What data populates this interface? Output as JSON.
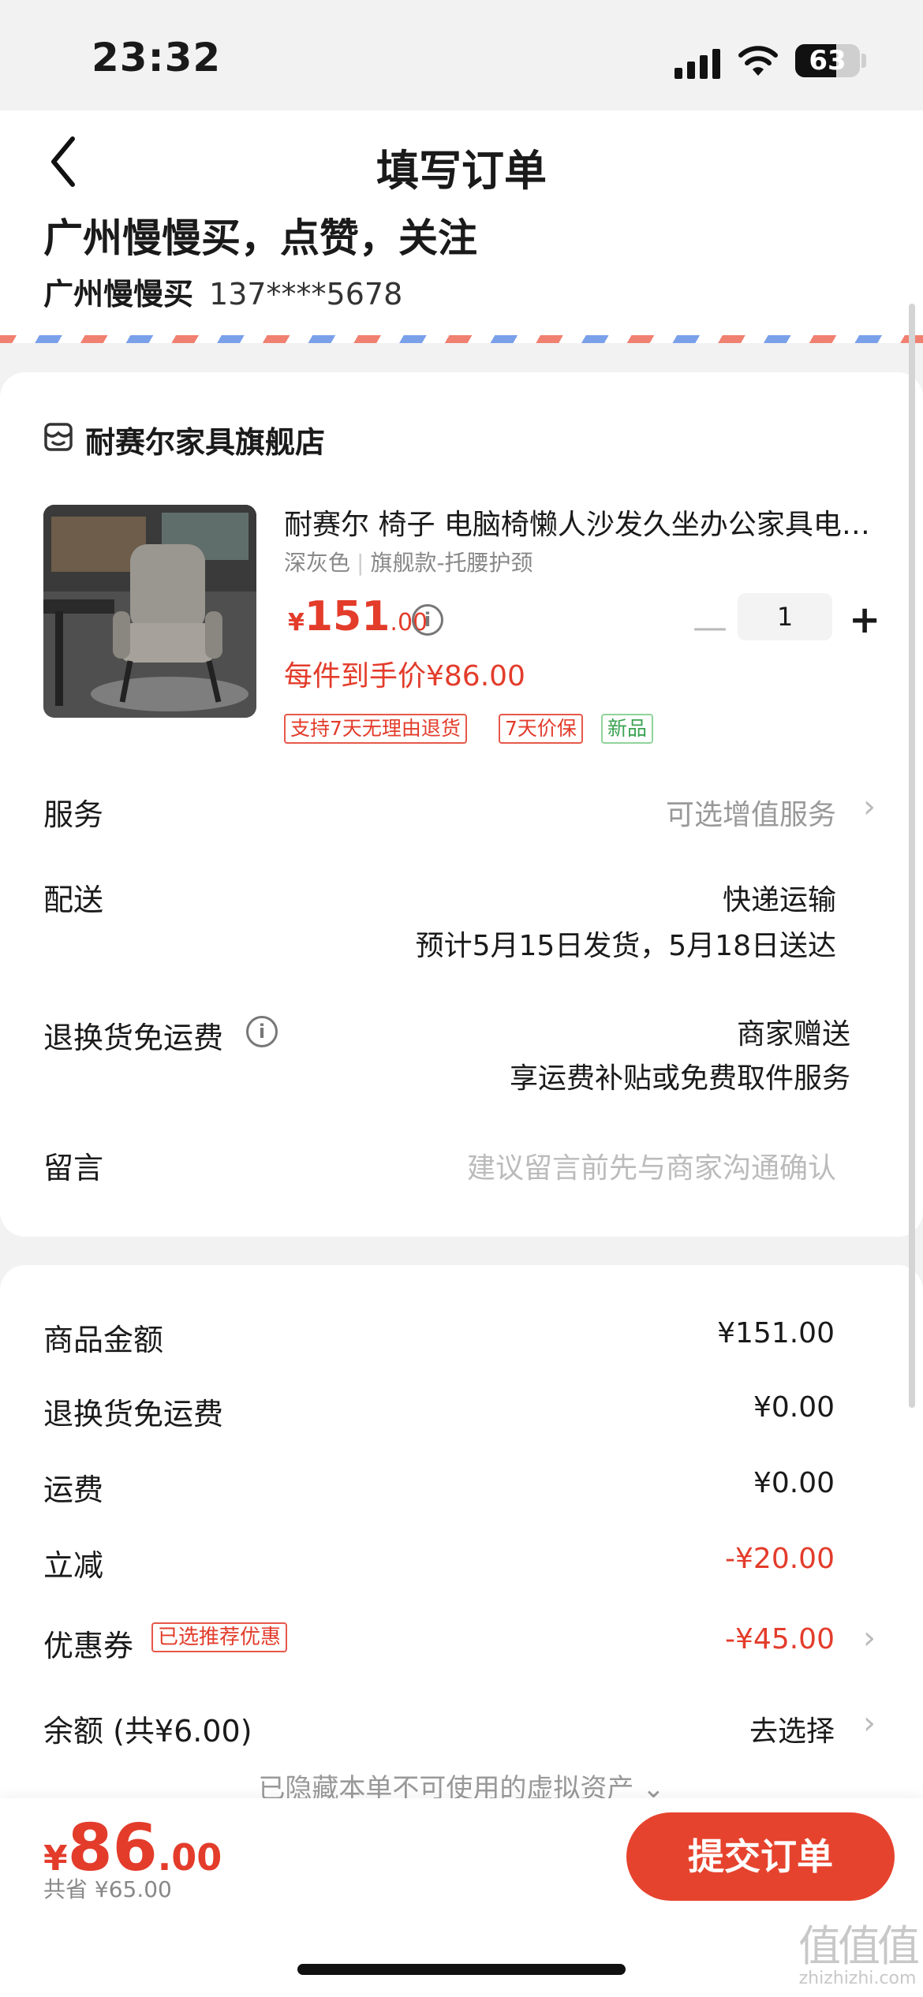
{
  "status_bar": {
    "time": "23:32",
    "battery": "63"
  },
  "header": {
    "title": "填写订单"
  },
  "address": {
    "name_line": "广州慢慢买，点赞，关注",
    "contact_name": "广州慢慢买",
    "phone": "137****5678"
  },
  "store": {
    "name": "耐赛尔家具旗舰店"
  },
  "product": {
    "title": "耐赛尔 椅子 电脑椅懒人沙发久坐办公家具电竞椅",
    "spec_color": "深灰色",
    "spec_model": "旗舰款-托腰护颈",
    "price_currency": "¥",
    "price_int": "151",
    "price_dec": ".00",
    "unit_price": "每件到手价¥86.00",
    "quantity": "1",
    "tags": [
      "支持7天无理由退货",
      "7天价保",
      "新品"
    ]
  },
  "rows": {
    "service_label": "服务",
    "service_value": "可选增值服务",
    "delivery_label": "配送",
    "delivery_method": "快递运输",
    "delivery_eta": "预计5月15日发货，5月18日送达",
    "return_label": "退换货免运费",
    "return_value1": "商家赠送",
    "return_value2": "享运费补贴或免费取件服务",
    "note_label": "留言",
    "note_placeholder": "建议留言前先与商家沟通确认"
  },
  "summary": {
    "goods_label": "商品金额",
    "goods_value": "¥151.00",
    "return_label": "退换货免运费",
    "return_value": "¥0.00",
    "shipping_label": "运费",
    "shipping_value": "¥0.00",
    "discount_label": "立减",
    "discount_value": "-¥20.00",
    "coupon_label": "优惠券",
    "coupon_badge": "已选推荐优惠",
    "coupon_value": "-¥45.00",
    "balance_label": "余额 (共¥6.00)",
    "balance_value": "去选择",
    "hidden_note": "已隐藏本单不可使用的虚拟资产 ⌄"
  },
  "footer": {
    "total_currency": "¥",
    "total_int": "86",
    "total_dec": ".00",
    "saved": "共省 ¥65.00",
    "submit_label": "提交订单"
  },
  "watermark": {
    "glyphs": "值值值",
    "domain": "zhizhizhi.com"
  },
  "colors": {
    "accent_red": "#e33c2b",
    "button_red": "#e6432e"
  }
}
